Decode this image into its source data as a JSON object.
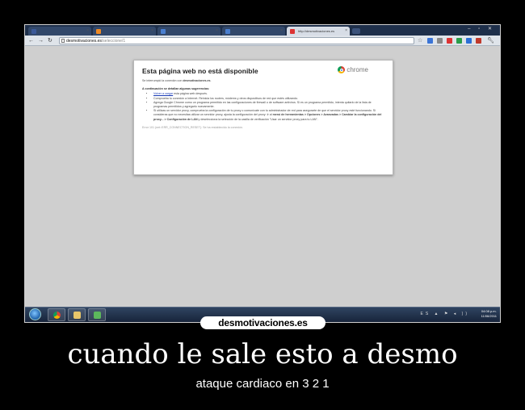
{
  "browser": {
    "tabs": [
      {
        "label": "",
        "icon": "facebook-icon",
        "color": "#3b5998",
        "active": false
      },
      {
        "label": "",
        "icon": "orange-site-icon",
        "color": "#f08a24",
        "active": false
      },
      {
        "label": "",
        "icon": "blue-site-icon",
        "color": "#4a7fd0",
        "active": false
      },
      {
        "label": "",
        "icon": "blue-site-icon",
        "color": "#4a7fd0",
        "active": false
      },
      {
        "label": "http://desmotivaciones.es",
        "icon": "error-page-icon",
        "color": "#d33",
        "active": true
      }
    ],
    "url_host": "desmotivaciones.es",
    "url_rest": "/seleccione/1",
    "window_controls": "–  ▫  ✕"
  },
  "error_page": {
    "title": "Esta página web no está disponible",
    "brand": "chrome",
    "interrupted_prefix": "Se interrumpió la conexión con",
    "interrupted_host": "desmotivaciones.es",
    "suggestions_heading": "A continuación se detallan algunas sugerencias:",
    "suggestion_1_link": "Volver a cargar",
    "suggestion_1_rest": "esta página web después.",
    "suggestion_2": "Comprueba tu conexión a Internet. Reinicia los routers, módems y otros dispositivos de red que estés utilizando.",
    "suggestion_3": "Agrega Google Chrome como un programa permitido en las configuraciones de firewall o de software antivirus. Si es un programa permitido, intenta quitarlo de la lista de programas permitidos y agregarlo nuevamente.",
    "suggestion_4_a": "Si utilizas un servidor proxy, comprueba la configuración de tu proxy o comunícate con tu administrador de red para asegurarte de que el servidor proxy esté funcionando. Si consideras que no necesitas utilizar un servidor proxy, ajusta la configuración del proxy: Ir al",
    "suggestion_4_b": "menú de herramientas > Opciones > Avanzadas > Cambiar la configuración del proxy... > Configuración de LAN",
    "suggestion_4_c": "y deselecciona la selección de la casilla de verificación \"Usar un servidor proxy para tu LAN\".",
    "error_code": "Error 101 (net::ERR_CONNECTION_RESET): Se ha restablecido la conexión."
  },
  "taskbar": {
    "tray_icons": "ES ▲ ⚑ ◂ ))",
    "time": "04:08 p.m.",
    "date": "11/06/2011"
  },
  "watermark": "desmotivaciones.es",
  "caption": "cuando le sale esto a desmo",
  "subcaption": "ataque cardiaco en 3 2 1"
}
